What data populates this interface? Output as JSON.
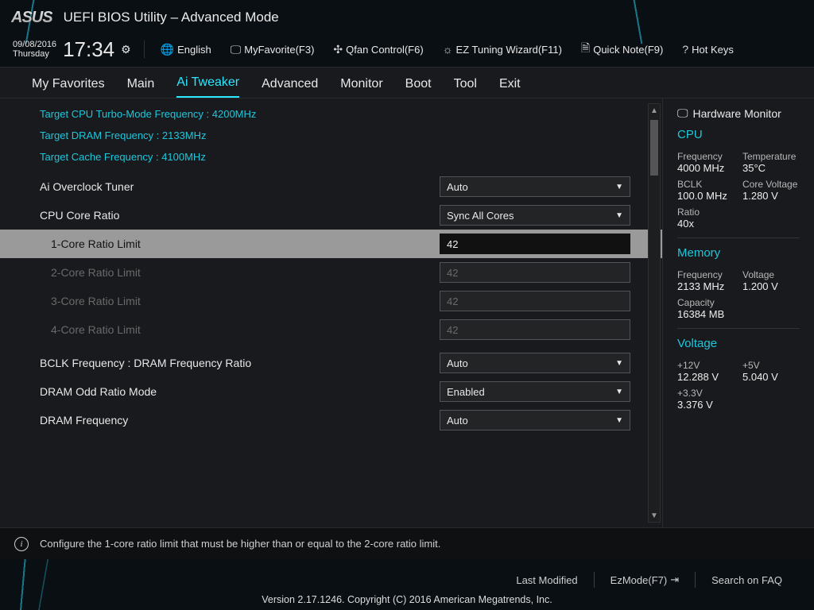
{
  "brand": "ASUS",
  "app_title": "UEFI BIOS Utility – Advanced Mode",
  "date": "09/08/2016",
  "day": "Thursday",
  "time": "17:34",
  "toolbar": {
    "language": "English",
    "myfavorite": "MyFavorite(F3)",
    "qfan": "Qfan Control(F6)",
    "eztuning": "EZ Tuning Wizard(F11)",
    "quicknote": "Quick Note(F9)",
    "hotkeys": "Hot Keys"
  },
  "tabs": [
    "My Favorites",
    "Main",
    "Ai Tweaker",
    "Advanced",
    "Monitor",
    "Boot",
    "Tool",
    "Exit"
  ],
  "active_tab": 2,
  "targets": [
    "Target CPU Turbo-Mode Frequency : 4200MHz",
    "Target DRAM Frequency : 2133MHz",
    "Target Cache Frequency : 4100MHz"
  ],
  "settings": {
    "ai_overclock_tuner": {
      "label": "Ai Overclock Tuner",
      "value": "Auto",
      "type": "select"
    },
    "cpu_core_ratio": {
      "label": "CPU Core Ratio",
      "value": "Sync All Cores",
      "type": "select"
    },
    "core1": {
      "label": "1-Core Ratio Limit",
      "value": "42",
      "type": "input"
    },
    "core2": {
      "label": "2-Core Ratio Limit",
      "value": "42",
      "type": "input"
    },
    "core3": {
      "label": "3-Core Ratio Limit",
      "value": "42",
      "type": "input"
    },
    "core4": {
      "label": "4-Core Ratio Limit",
      "value": "42",
      "type": "input"
    },
    "bclk_dram_ratio": {
      "label": "BCLK Frequency : DRAM Frequency Ratio",
      "value": "Auto",
      "type": "select"
    },
    "dram_odd_ratio": {
      "label": "DRAM Odd Ratio Mode",
      "value": "Enabled",
      "type": "select"
    },
    "dram_freq": {
      "label": "DRAM Frequency",
      "value": "Auto",
      "type": "select"
    }
  },
  "help_text": "Configure the 1-core ratio limit that must be higher than or equal to the 2-core ratio limit.",
  "side": {
    "title": "Hardware Monitor",
    "cpu": {
      "title": "CPU",
      "frequency_label": "Frequency",
      "frequency": "4000 MHz",
      "temperature_label": "Temperature",
      "temperature": "35°C",
      "bclk_label": "BCLK",
      "bclk": "100.0 MHz",
      "corev_label": "Core Voltage",
      "corev": "1.280 V",
      "ratio_label": "Ratio",
      "ratio": "40x"
    },
    "memory": {
      "title": "Memory",
      "frequency_label": "Frequency",
      "frequency": "2133 MHz",
      "voltage_label": "Voltage",
      "voltage": "1.200 V",
      "capacity_label": "Capacity",
      "capacity": "16384 MB"
    },
    "voltage": {
      "title": "Voltage",
      "v12_label": "+12V",
      "v12": "12.288 V",
      "v5_label": "+5V",
      "v5": "5.040 V",
      "v33_label": "+3.3V",
      "v33": "3.376 V"
    }
  },
  "footer": {
    "last_modified": "Last Modified",
    "ezmode": "EzMode(F7)",
    "search": "Search on FAQ",
    "copyright": "Version 2.17.1246. Copyright (C) 2016 American Megatrends, Inc."
  }
}
